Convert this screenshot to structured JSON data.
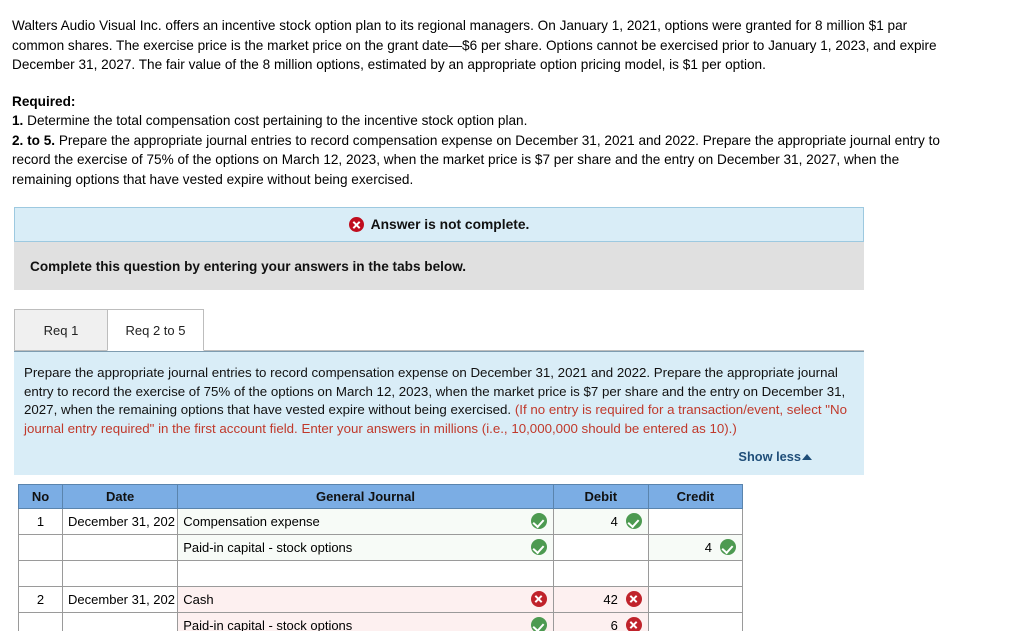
{
  "problem": {
    "text": "Walters Audio Visual Inc. offers an incentive stock option plan to its regional managers. On January 1, 2021, options were granted for 8 million $1 par common shares. The exercise price is the market price on the grant date—$6 per share. Options cannot be exercised prior to January 1, 2023, and expire December 31, 2027. The fair value of the 8 million options, estimated by an appropriate option pricing model, is $1 per option."
  },
  "required": {
    "heading": "Required:",
    "item1_label": "1.",
    "item1_text": " Determine the total compensation cost pertaining to the incentive stock option plan.",
    "item2_label": "2. to 5.",
    "item2_text": " Prepare the appropriate journal entries to record compensation expense on December 31, 2021 and 2022. Prepare the appropriate journal entry to record the exercise of 75% of the options on March 12, 2023, when the market price is $7 per share and the entry on December 31, 2027, when the remaining options that have vested expire without being exercised."
  },
  "alert": {
    "text": "Answer is not complete.",
    "icon": "error-circle-icon",
    "color": "#c00d1e",
    "background": "#d9edf7"
  },
  "instruction_bar": {
    "text": "Complete this question by entering your answers in the tabs below.",
    "background": "#e0e0e0"
  },
  "tabs": [
    {
      "label": "Req 1",
      "active": false
    },
    {
      "label": "Req 2 to 5",
      "active": true
    }
  ],
  "instruction_panel": {
    "black_text": "Prepare the appropriate journal entries to record compensation expense on December 31, 2021 and 2022. Prepare the appropriate journal entry to record the exercise of 75% of the options on March 12, 2023, when the market price is $7 per share and the entry on December 31, 2027, when the remaining options that have vested expire without being exercised. ",
    "red_text": "(If no entry is required for a transaction/event, select \"No journal entry required\" in the first account field. Enter your answers in millions (i.e., 10,000,000 should be entered as 10).)",
    "show_less_label": "Show less",
    "background": "#d9edf7",
    "red_color": "#c0392b",
    "link_color": "#1f4e79"
  },
  "journal_table": {
    "headers": [
      "No",
      "Date",
      "General Journal",
      "Debit",
      "Credit"
    ],
    "header_background": "#7bade4",
    "rows": [
      {
        "no": "1",
        "date": "December 31, 202",
        "account": "Compensation expense",
        "indent": false,
        "account_mark": "ok",
        "debit": "4",
        "debit_mark": "ok",
        "credit": "",
        "credit_mark": "",
        "row_state": "ok"
      },
      {
        "no": "",
        "date": "",
        "account": "Paid-in capital - stock options",
        "indent": true,
        "account_mark": "ok",
        "debit": "",
        "debit_mark": "",
        "credit": "4",
        "credit_mark": "ok",
        "row_state": "ok"
      },
      {
        "no": "",
        "date": "",
        "account": "",
        "indent": false,
        "account_mark": "",
        "debit": "",
        "debit_mark": "",
        "credit": "",
        "credit_mark": "",
        "row_state": "none"
      },
      {
        "no": "2",
        "date": "December 31, 202",
        "account": "Cash",
        "indent": false,
        "account_mark": "bad",
        "debit": "42",
        "debit_mark": "bad",
        "credit": "",
        "credit_mark": "",
        "row_state": "bad"
      },
      {
        "no": "",
        "date": "",
        "account": "Paid-in capital - stock options",
        "indent": true,
        "account_mark": "ok",
        "debit": "6",
        "debit_mark": "bad",
        "credit": "",
        "credit_mark": "",
        "row_state": "bad"
      }
    ]
  }
}
